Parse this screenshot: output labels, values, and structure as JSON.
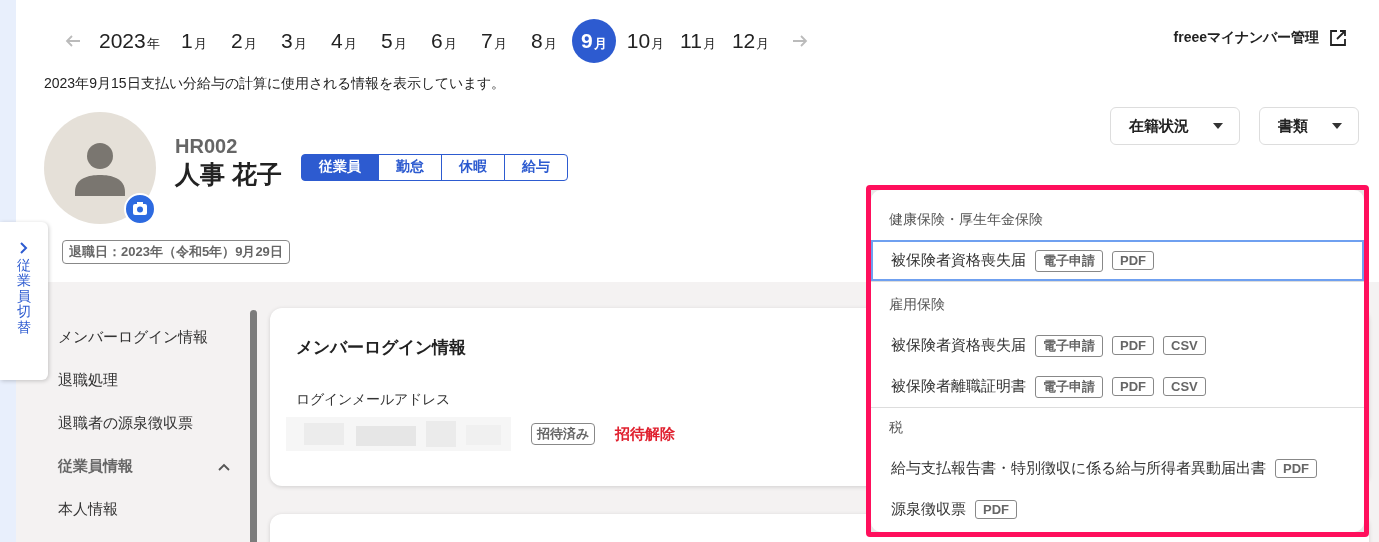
{
  "month_nav": {
    "year": {
      "number": "2023",
      "unit": "年"
    },
    "months": [
      {
        "number": "1",
        "unit": "月",
        "selected": false
      },
      {
        "number": "2",
        "unit": "月",
        "selected": false
      },
      {
        "number": "3",
        "unit": "月",
        "selected": false
      },
      {
        "number": "4",
        "unit": "月",
        "selected": false
      },
      {
        "number": "5",
        "unit": "月",
        "selected": false
      },
      {
        "number": "6",
        "unit": "月",
        "selected": false
      },
      {
        "number": "7",
        "unit": "月",
        "selected": false
      },
      {
        "number": "8",
        "unit": "月",
        "selected": false
      },
      {
        "number": "9",
        "unit": "月",
        "selected": true
      },
      {
        "number": "10",
        "unit": "月",
        "selected": false
      },
      {
        "number": "11",
        "unit": "月",
        "selected": false
      },
      {
        "number": "12",
        "unit": "月",
        "selected": false
      }
    ]
  },
  "external_link": {
    "label": "freeeマイナンバー管理"
  },
  "notice": "2023年9月15日支払い分給与の計算に使用される情報を表示しています。",
  "employee": {
    "code": "HR002",
    "name": "人事 花子",
    "tabs": [
      {
        "label": "従業員",
        "selected": true
      },
      {
        "label": "勤怠",
        "selected": false
      },
      {
        "label": "休暇",
        "selected": false
      },
      {
        "label": "給与",
        "selected": false
      }
    ],
    "retirement_badge": "退職日：2023年（令和5年）9月29日"
  },
  "header_buttons": [
    {
      "label": "在籍状況"
    },
    {
      "label": "書類"
    }
  ],
  "side_tab": {
    "label": "従業員切替"
  },
  "sidebar": {
    "items": [
      {
        "label": "メンバーログイン情報",
        "kind": "link"
      },
      {
        "label": "退職処理",
        "kind": "link"
      },
      {
        "label": "退職者の源泉徴収票",
        "kind": "link"
      },
      {
        "label": "従業員情報",
        "kind": "section",
        "expanded": true
      },
      {
        "label": "本人情報",
        "kind": "link"
      }
    ]
  },
  "card": {
    "title": "メンバーログイン情報",
    "field_label": "ログインメールアドレス",
    "status_badge": "招待済み",
    "action_link": "招待解除"
  },
  "documents_menu": {
    "groups": [
      {
        "heading": "健康保険・厚生年金保険",
        "items": [
          {
            "label": "被保険者資格喪失届",
            "focused": true,
            "tags": [
              "電子申請",
              "PDF"
            ]
          }
        ]
      },
      {
        "heading": "雇用保険",
        "items": [
          {
            "label": "被保険者資格喪失届",
            "focused": false,
            "tags": [
              "電子申請",
              "PDF",
              "CSV"
            ]
          },
          {
            "label": "被保険者離職証明書",
            "focused": false,
            "tags": [
              "電子申請",
              "PDF",
              "CSV"
            ]
          }
        ]
      },
      {
        "heading": "税",
        "items": [
          {
            "label": "給与支払報告書・特別徴収に係る給与所得者異動届出書",
            "focused": false,
            "tags": [
              "PDF"
            ]
          },
          {
            "label": "源泉徴収票",
            "focused": false,
            "tags": [
              "PDF"
            ]
          }
        ]
      }
    ]
  }
}
